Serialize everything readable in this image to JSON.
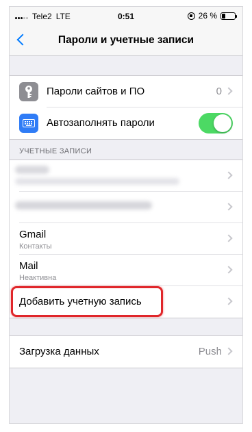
{
  "status_bar": {
    "carrier": "Tele2",
    "network": "LTE",
    "time": "0:51",
    "battery_percent": "26 %"
  },
  "nav": {
    "back_icon": "chevron-left-icon",
    "title": "Пароли и учетные записи"
  },
  "group_passwords": {
    "items": [
      {
        "icon": "key-icon",
        "label": "Пароли сайтов и ПО",
        "value": "0"
      },
      {
        "icon": "keyboard-icon",
        "label": "Автозаполнять пароли",
        "toggle_on": true
      }
    ]
  },
  "accounts_section": {
    "header": "УЧЕТНЫЕ ЗАПИСИ",
    "accounts": [
      {
        "title": "Gmail",
        "subtitle": "Контакты"
      },
      {
        "title": "Mail",
        "subtitle": "Неактивна"
      }
    ],
    "add_account_label": "Добавить учетную запись"
  },
  "fetch_group": {
    "label": "Загрузка данных",
    "value": "Push"
  },
  "colors": {
    "accent": "#007aff",
    "toggle_on": "#4cd964",
    "highlight": "#e0262a"
  }
}
